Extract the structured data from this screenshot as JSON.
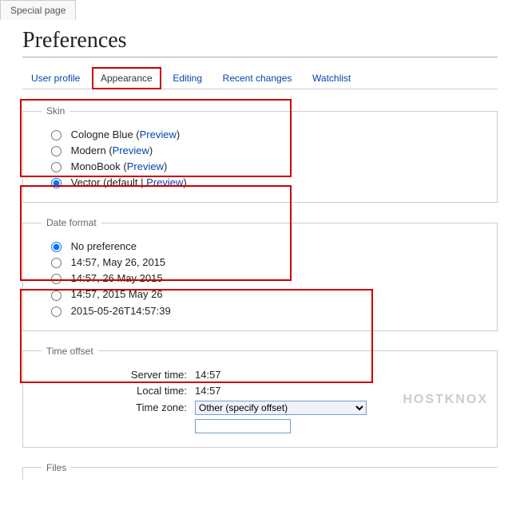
{
  "page_tab": "Special page",
  "title": "Preferences",
  "tabs": [
    {
      "label": "User profile",
      "active": false
    },
    {
      "label": "Appearance",
      "active": true
    },
    {
      "label": "Editing",
      "active": false
    },
    {
      "label": "Recent changes",
      "active": false
    },
    {
      "label": "Watchlist",
      "active": false
    }
  ],
  "skin": {
    "legend": "Skin",
    "options": [
      {
        "label": "Cologne Blue",
        "preview": "Preview",
        "selected": false
      },
      {
        "label": "Modern",
        "preview": "Preview",
        "selected": false
      },
      {
        "label": "MonoBook",
        "preview": "Preview",
        "selected": false
      },
      {
        "label": "Vector",
        "suffix_before": "default",
        "preview": "Preview",
        "selected": true
      }
    ]
  },
  "date_format": {
    "legend": "Date format",
    "options": [
      {
        "label": "No preference",
        "selected": true
      },
      {
        "label": "14:57, May 26, 2015",
        "selected": false
      },
      {
        "label": "14:57, 26 May 2015",
        "selected": false
      },
      {
        "label": "14:57, 2015 May 26",
        "selected": false
      },
      {
        "label": "2015-05-26T14:57:39",
        "selected": false
      }
    ]
  },
  "time_offset": {
    "legend": "Time offset",
    "server_time_label": "Server time:",
    "server_time_value": "14:57",
    "local_time_label": "Local time:",
    "local_time_value": "14:57",
    "timezone_label": "Time zone:",
    "timezone_value": "Other (specify offset)",
    "offset_input": ""
  },
  "files": {
    "legend": "Files"
  },
  "watermark": "HOSTKNOX"
}
